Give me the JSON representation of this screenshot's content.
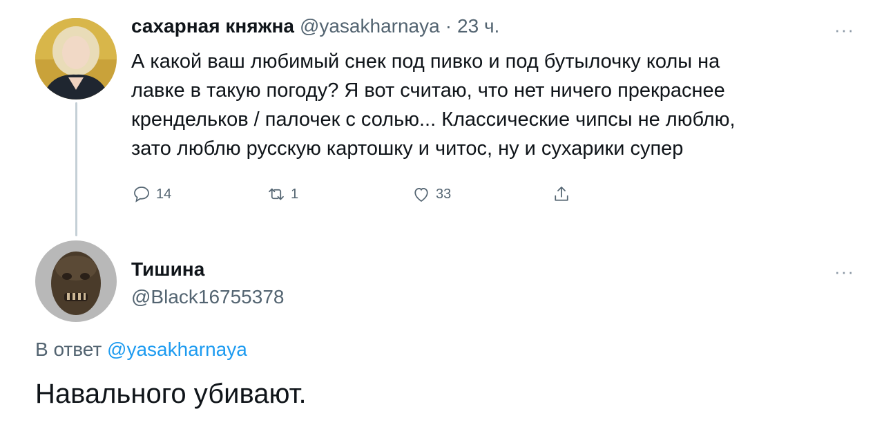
{
  "tweet1": {
    "author_name": "сахарная княжна",
    "handle": "@yasakharnaya",
    "separator": "·",
    "time": "23 ч.",
    "text_lines": [
      "А какой ваш любимый снек под пивко и под бутылочку колы на",
      "лавке в такую погоду? Я вот считаю, что нет ничего прекраснее",
      "крендельков / палочек с солью... Классические чипсы не люблю,",
      "зато люблю русскую картошку и читос, ну и сухарики супер"
    ],
    "actions": {
      "reply_count": "14",
      "retweet_count": "1",
      "like_count": "33"
    }
  },
  "tweet2": {
    "author_name": "Тишина",
    "handle": "@Black16755378",
    "reply_prefix": "В ответ",
    "reply_mention": "@yasakharnaya",
    "text": "Навального убивают."
  },
  "more_label": "···",
  "icons": {
    "reply": "comment-bubble-icon",
    "retweet": "retweet-icon",
    "like": "heart-icon",
    "share": "share-icon",
    "more": "more-dots-icon"
  },
  "colors": {
    "text": "#0f1419",
    "secondary": "#536471",
    "link": "#1d9bf0",
    "thread_line": "#c4cfd6"
  }
}
